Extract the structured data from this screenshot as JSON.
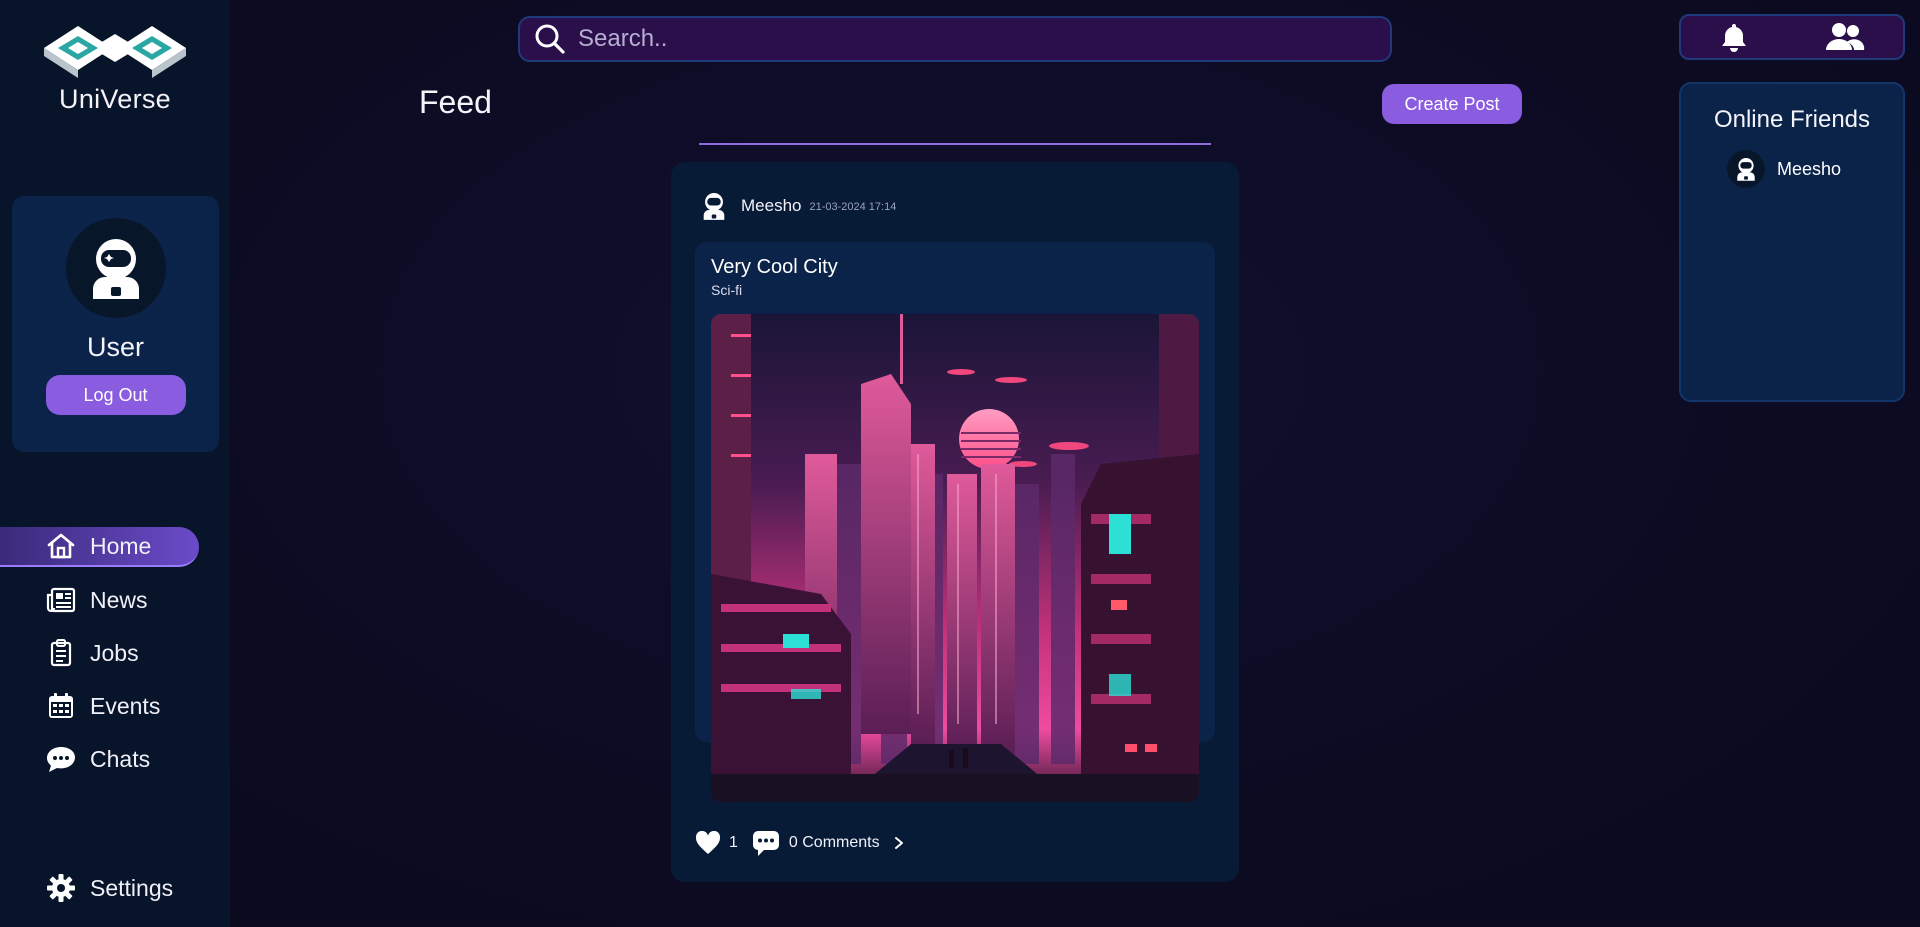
{
  "app": {
    "name": "UniVerse"
  },
  "profile": {
    "name": "User",
    "logout_label": "Log Out",
    "avatar_icon": "astronaut-icon"
  },
  "nav": {
    "items": [
      {
        "label": "Home",
        "icon": "home-icon",
        "active": true
      },
      {
        "label": "News",
        "icon": "newspaper-icon"
      },
      {
        "label": "Jobs",
        "icon": "clipboard-icon"
      },
      {
        "label": "Events",
        "icon": "calendar-icon"
      },
      {
        "label": "Chats",
        "icon": "chat-bubble-icon"
      }
    ],
    "settings_label": "Settings"
  },
  "search": {
    "placeholder": "Search.."
  },
  "feed": {
    "title": "Feed",
    "create_label": "Create Post"
  },
  "post": {
    "author": "Meesho",
    "date": "21-03-2024 17:14",
    "title": "Very Cool City",
    "category": "Sci-fi",
    "likes": "1",
    "comments_label": "0 Comments"
  },
  "friends": {
    "title": "Online Friends",
    "list": [
      {
        "name": "Meesho"
      }
    ]
  },
  "colors": {
    "accent": "#8a5ce0",
    "sidebar_bg": "#08142a",
    "card_bg": "#0b2349",
    "search_bg": "#2a0f4a"
  }
}
